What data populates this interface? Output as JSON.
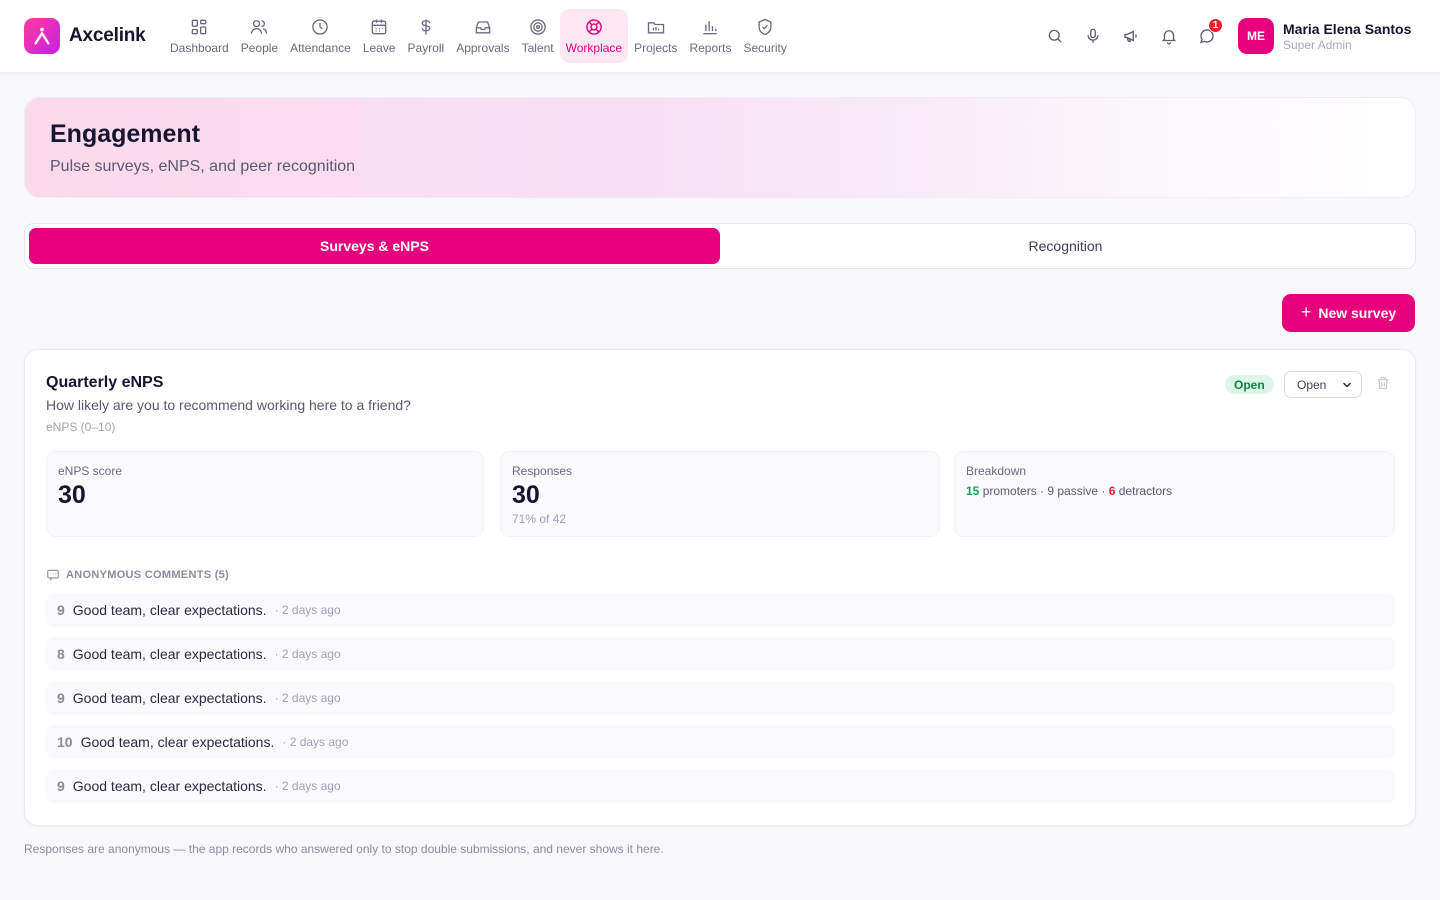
{
  "app": {
    "name": "Axcelink"
  },
  "nav": [
    {
      "label": "Dashboard",
      "icon": "dashboard-icon"
    },
    {
      "label": "People",
      "icon": "people-icon"
    },
    {
      "label": "Attendance",
      "icon": "clock-icon"
    },
    {
      "label": "Leave",
      "icon": "calendar-icon"
    },
    {
      "label": "Payroll",
      "icon": "dollar-icon"
    },
    {
      "label": "Approvals",
      "icon": "inbox-icon"
    },
    {
      "label": "Talent",
      "icon": "target-icon"
    },
    {
      "label": "Workplace",
      "icon": "lifebuoy-icon",
      "active": true
    },
    {
      "label": "Projects",
      "icon": "projects-icon"
    },
    {
      "label": "Reports",
      "icon": "bar-chart-icon"
    },
    {
      "label": "Security",
      "icon": "shield-icon"
    }
  ],
  "toolbar": {
    "messages_badge": "1"
  },
  "user": {
    "initials": "ME",
    "name": "Maria Elena Santos",
    "role": "Super Admin"
  },
  "colors": {
    "accent": "#e6007e",
    "accent_soft": "#fde7f2",
    "success": "#13824a",
    "danger": "#e6232d"
  },
  "hero": {
    "title": "Engagement",
    "subtitle": "Pulse surveys, eNPS, and peer recognition"
  },
  "tabs": [
    {
      "label": "Surveys & eNPS",
      "active": true
    },
    {
      "label": "Recognition",
      "active": false
    }
  ],
  "actions": {
    "new_survey": "New survey"
  },
  "survey": {
    "title": "Quarterly eNPS",
    "question": "How likely are you to recommend working here to a friend?",
    "type": "eNPS (0–10)",
    "status_badge": "Open",
    "status_select": "Open",
    "stats": {
      "score_label": "eNPS score",
      "score_value": "30",
      "responses_label": "Responses",
      "responses_value": "30",
      "responses_sub": "71% of 42",
      "breakdown_label": "Breakdown",
      "promoters": "15",
      "promoters_label": " promoters · ",
      "passive": "9 passive · ",
      "detractors": "6",
      "detractors_label": " detractors"
    },
    "comments_header": "ANONYMOUS COMMENTS (5)",
    "comments": [
      {
        "score": "9",
        "text": "Good team, clear expectations.",
        "time": "· 2 days ago"
      },
      {
        "score": "8",
        "text": "Good team, clear expectations.",
        "time": "· 2 days ago"
      },
      {
        "score": "9",
        "text": "Good team, clear expectations.",
        "time": "· 2 days ago"
      },
      {
        "score": "10",
        "text": "Good team, clear expectations.",
        "time": "· 2 days ago"
      },
      {
        "score": "9",
        "text": "Good team, clear expectations.",
        "time": "· 2 days ago"
      }
    ]
  },
  "footnote": "Responses are anonymous — the app records who answered only to stop double submissions, and never shows it here."
}
